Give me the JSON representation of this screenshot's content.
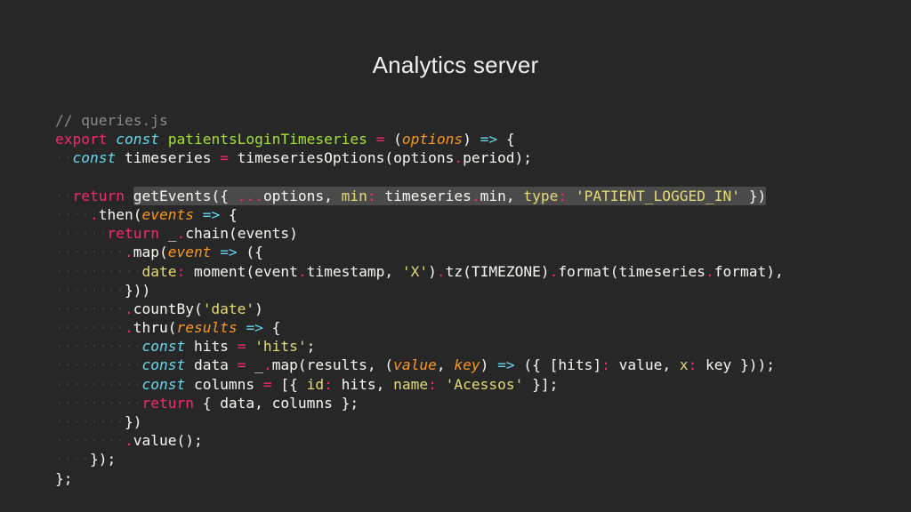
{
  "slide": {
    "title": "Analytics server"
  },
  "colors": {
    "background": "#272727",
    "comment": "#8a8a8a",
    "keyword": "#f92672",
    "storage": "#66d9ef",
    "function": "#a6e22e",
    "parameter": "#fd971f",
    "string": "#e6db74",
    "plain": "#f8f8f2",
    "highlight": "#4a4a4a"
  },
  "code": {
    "language": "javascript",
    "lines": [
      {
        "id": "l1",
        "indent": "",
        "tokens": [
          {
            "type": "comment",
            "text": "// queries.js"
          }
        ]
      },
      {
        "id": "l2",
        "indent": "",
        "tokens": [
          {
            "type": "kw",
            "text": "export"
          },
          {
            "type": "plain",
            "text": " "
          },
          {
            "type": "storage",
            "text": "const"
          },
          {
            "type": "plain",
            "text": " "
          },
          {
            "type": "fn",
            "text": "patientsLoginTimeseries"
          },
          {
            "type": "plain",
            "text": " "
          },
          {
            "type": "op",
            "text": "="
          },
          {
            "type": "plain",
            "text": " ("
          },
          {
            "type": "param",
            "text": "options"
          },
          {
            "type": "plain",
            "text": ") "
          },
          {
            "type": "storage",
            "text": "=>"
          },
          {
            "type": "plain",
            "text": " {"
          }
        ]
      },
      {
        "id": "l3",
        "indent": "··",
        "tokens": [
          {
            "type": "storage",
            "text": "const"
          },
          {
            "type": "plain",
            "text": " timeseries "
          },
          {
            "type": "op",
            "text": "="
          },
          {
            "type": "plain",
            "text": " timeseriesOptions(options"
          },
          {
            "type": "dot",
            "text": "."
          },
          {
            "type": "plain",
            "text": "period);"
          }
        ]
      },
      {
        "id": "l4",
        "indent": "",
        "tokens": []
      },
      {
        "id": "l5",
        "indent": "··",
        "tokens": [
          {
            "type": "kw",
            "text": "return"
          },
          {
            "type": "plain",
            "text": " "
          },
          {
            "type": "plain",
            "text": "getEvents({ ",
            "hl": true
          },
          {
            "type": "op",
            "text": "...",
            "hl": true
          },
          {
            "type": "plain",
            "text": "options, ",
            "hl": true
          },
          {
            "type": "prop",
            "text": "min",
            "hl": true
          },
          {
            "type": "op",
            "text": ":",
            "hl": true
          },
          {
            "type": "plain",
            "text": " timeseries",
            "hl": true
          },
          {
            "type": "dot",
            "text": ".",
            "hl": true
          },
          {
            "type": "plain",
            "text": "min, ",
            "hl": true
          },
          {
            "type": "prop",
            "text": "type",
            "hl": true
          },
          {
            "type": "op",
            "text": ":",
            "hl": true
          },
          {
            "type": "plain",
            "text": " ",
            "hl": true
          },
          {
            "type": "str",
            "text": "'PATIENT_LOGGED_IN'",
            "hl": true
          },
          {
            "type": "plain",
            "text": " })",
            "hl": true
          }
        ]
      },
      {
        "id": "l6",
        "indent": "····",
        "tokens": [
          {
            "type": "dot",
            "text": "."
          },
          {
            "type": "plain",
            "text": "then("
          },
          {
            "type": "param",
            "text": "events"
          },
          {
            "type": "plain",
            "text": " "
          },
          {
            "type": "storage",
            "text": "=>"
          },
          {
            "type": "plain",
            "text": " {"
          }
        ]
      },
      {
        "id": "l7",
        "indent": "······",
        "tokens": [
          {
            "type": "kw",
            "text": "return"
          },
          {
            "type": "plain",
            "text": " _"
          },
          {
            "type": "dot",
            "text": "."
          },
          {
            "type": "plain",
            "text": "chain(events)"
          }
        ]
      },
      {
        "id": "l8",
        "indent": "········",
        "tokens": [
          {
            "type": "dot",
            "text": "."
          },
          {
            "type": "plain",
            "text": "map("
          },
          {
            "type": "param",
            "text": "event"
          },
          {
            "type": "plain",
            "text": " "
          },
          {
            "type": "storage",
            "text": "=>"
          },
          {
            "type": "plain",
            "text": " ({"
          }
        ]
      },
      {
        "id": "l9",
        "indent": "··········",
        "tokens": [
          {
            "type": "prop",
            "text": "date"
          },
          {
            "type": "op",
            "text": ":"
          },
          {
            "type": "plain",
            "text": " moment(event"
          },
          {
            "type": "dot",
            "text": "."
          },
          {
            "type": "plain",
            "text": "timestamp, "
          },
          {
            "type": "str",
            "text": "'X'"
          },
          {
            "type": "plain",
            "text": ")"
          },
          {
            "type": "dot",
            "text": "."
          },
          {
            "type": "plain",
            "text": "tz(TIMEZONE)"
          },
          {
            "type": "dot",
            "text": "."
          },
          {
            "type": "plain",
            "text": "format(timeseries"
          },
          {
            "type": "dot",
            "text": "."
          },
          {
            "type": "plain",
            "text": "format),"
          }
        ]
      },
      {
        "id": "l10",
        "indent": "········",
        "tokens": [
          {
            "type": "plain",
            "text": "}))"
          }
        ]
      },
      {
        "id": "l11",
        "indent": "········",
        "tokens": [
          {
            "type": "dot",
            "text": "."
          },
          {
            "type": "plain",
            "text": "countBy("
          },
          {
            "type": "str",
            "text": "'date'"
          },
          {
            "type": "plain",
            "text": ")"
          }
        ]
      },
      {
        "id": "l12",
        "indent": "········",
        "tokens": [
          {
            "type": "dot",
            "text": "."
          },
          {
            "type": "plain",
            "text": "thru("
          },
          {
            "type": "param",
            "text": "results"
          },
          {
            "type": "plain",
            "text": " "
          },
          {
            "type": "storage",
            "text": "=>"
          },
          {
            "type": "plain",
            "text": " {"
          }
        ]
      },
      {
        "id": "l13",
        "indent": "··········",
        "tokens": [
          {
            "type": "storage",
            "text": "const"
          },
          {
            "type": "plain",
            "text": " hits "
          },
          {
            "type": "op",
            "text": "="
          },
          {
            "type": "plain",
            "text": " "
          },
          {
            "type": "str",
            "text": "'hits'"
          },
          {
            "type": "plain",
            "text": ";"
          }
        ]
      },
      {
        "id": "l14",
        "indent": "··········",
        "tokens": [
          {
            "type": "storage",
            "text": "const"
          },
          {
            "type": "plain",
            "text": " data "
          },
          {
            "type": "op",
            "text": "="
          },
          {
            "type": "plain",
            "text": " _"
          },
          {
            "type": "dot",
            "text": "."
          },
          {
            "type": "plain",
            "text": "map(results, ("
          },
          {
            "type": "param",
            "text": "value"
          },
          {
            "type": "plain",
            "text": ", "
          },
          {
            "type": "param",
            "text": "key"
          },
          {
            "type": "plain",
            "text": ") "
          },
          {
            "type": "storage",
            "text": "=>"
          },
          {
            "type": "plain",
            "text": " ({ [hits]"
          },
          {
            "type": "op",
            "text": ":"
          },
          {
            "type": "plain",
            "text": " value, "
          },
          {
            "type": "prop",
            "text": "x"
          },
          {
            "type": "op",
            "text": ":"
          },
          {
            "type": "plain",
            "text": " key }));"
          }
        ]
      },
      {
        "id": "l15",
        "indent": "··········",
        "tokens": [
          {
            "type": "storage",
            "text": "const"
          },
          {
            "type": "plain",
            "text": " columns "
          },
          {
            "type": "op",
            "text": "="
          },
          {
            "type": "plain",
            "text": " [{ "
          },
          {
            "type": "prop",
            "text": "id"
          },
          {
            "type": "op",
            "text": ":"
          },
          {
            "type": "plain",
            "text": " hits, "
          },
          {
            "type": "prop",
            "text": "name"
          },
          {
            "type": "op",
            "text": ":"
          },
          {
            "type": "plain",
            "text": " "
          },
          {
            "type": "str",
            "text": "'Acessos'"
          },
          {
            "type": "plain",
            "text": " }];"
          }
        ]
      },
      {
        "id": "l16",
        "indent": "··········",
        "tokens": [
          {
            "type": "kw",
            "text": "return"
          },
          {
            "type": "plain",
            "text": " { data, columns };"
          }
        ]
      },
      {
        "id": "l17",
        "indent": "········",
        "tokens": [
          {
            "type": "plain",
            "text": "})"
          }
        ]
      },
      {
        "id": "l18",
        "indent": "········",
        "tokens": [
          {
            "type": "dot",
            "text": "."
          },
          {
            "type": "plain",
            "text": "value();"
          }
        ]
      },
      {
        "id": "l19",
        "indent": "····",
        "tokens": [
          {
            "type": "plain",
            "text": "});"
          }
        ]
      },
      {
        "id": "l20",
        "indent": "",
        "tokens": [
          {
            "type": "plain",
            "text": "};"
          }
        ]
      }
    ]
  }
}
